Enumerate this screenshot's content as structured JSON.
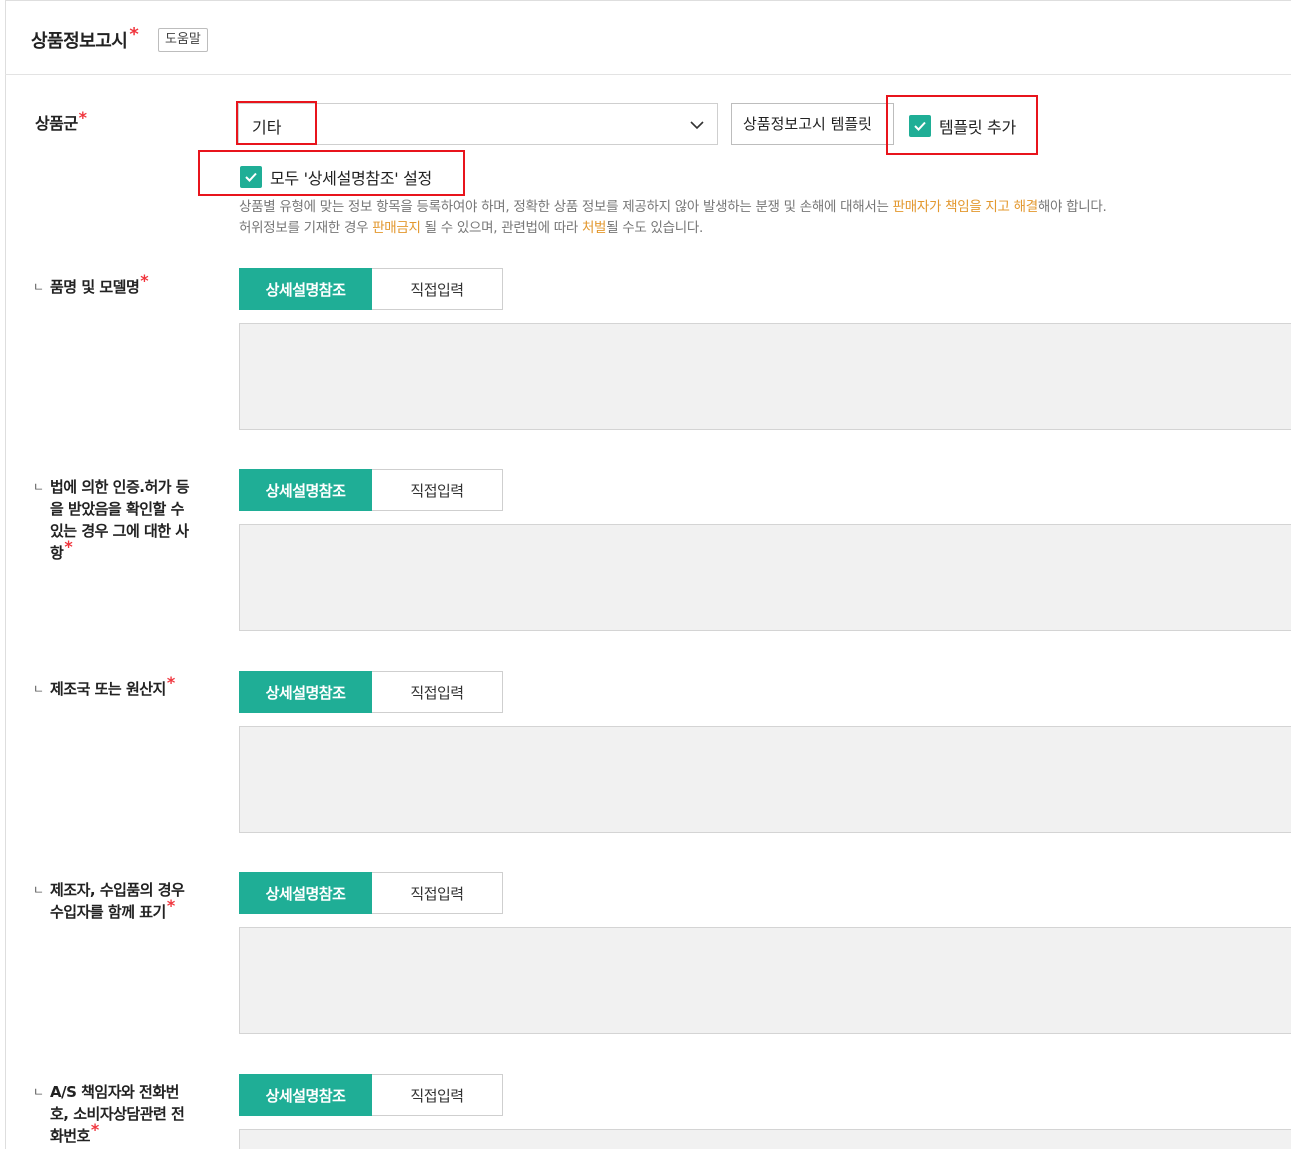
{
  "header": {
    "title": "상품정보고시",
    "required_mark": "*",
    "help_label": "도움말"
  },
  "product_group": {
    "label": "상품군",
    "required_mark": "*",
    "selected_value": "기타",
    "template_button_label": "상품정보고시 템플릿",
    "add_template_checkbox": {
      "label": "템플릿 추가",
      "checked": true
    },
    "all_detail_ref_checkbox": {
      "label": "모두 '상세설명참조' 설정",
      "checked": true
    }
  },
  "notice": {
    "line1_a": "상품별 유형에 맞는 정보 항목을 등록하여야 하며, 정확한 상품 정보를 제공하지 않아 발생하는 분쟁 및 손해에 대해서는 ",
    "line1_hl": "판매자가 책임을 지고 해결",
    "line1_b": "해야 합니다.",
    "line2_a": "허위정보를 기재한 경우 ",
    "line2_hl1": "판매금지",
    "line2_b": " 될 수 있으며, 관련법에 따라 ",
    "line2_hl2": "처벌",
    "line2_c": "될 수도 있습니다."
  },
  "fields": [
    {
      "label": "품명 및 모델명",
      "required_mark": "*",
      "option_on": "상세설명참조",
      "option_off": "직접입력"
    },
    {
      "label": "법에 의한 인증.허가 등을 받았음을 확인할 수 있는 경우 그에 대한 사항",
      "required_mark": "*",
      "option_on": "상세설명참조",
      "option_off": "직접입력"
    },
    {
      "label": "제조국 또는 원산지",
      "required_mark": "*",
      "option_on": "상세설명참조",
      "option_off": "직접입력"
    },
    {
      "label": "제조자, 수입품의 경우 수입자를 함께 표기",
      "required_mark": "*",
      "option_on": "상세설명참조",
      "option_off": "직접입력"
    },
    {
      "label": "A/S 책임자와 전화번호, 소비자상담관련 전화번호",
      "required_mark": "*",
      "option_on": "상세설명참조",
      "option_off": "직접입력"
    }
  ],
  "colors": {
    "accent": "#1fae96",
    "required": "#f0353d",
    "highlight": "#e3982f",
    "annotation_box": "#e8141c"
  }
}
